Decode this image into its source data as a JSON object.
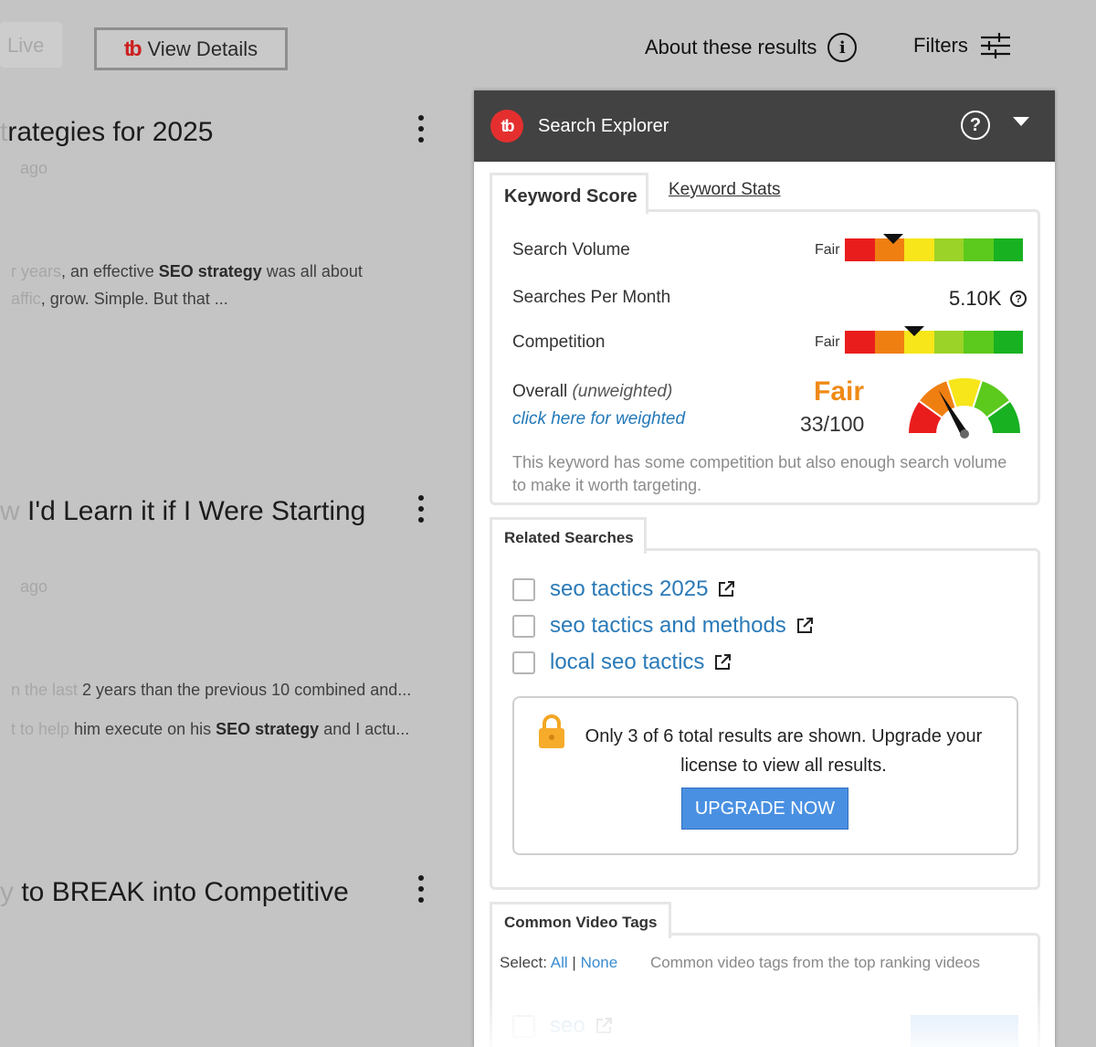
{
  "topbar": {
    "live_chip": "Live",
    "view_details_logo": "tb",
    "view_details": "View Details",
    "about_results": "About these results",
    "info_icon": "i",
    "filters": "Filters"
  },
  "videos": [
    {
      "title_fade": "t",
      "title": "rategies for 2025",
      "meta": "ago",
      "desc_lines": [
        {
          "fade": "r years",
          "pre": ", an effective ",
          "bold": "SEO strategy",
          "post": " was all about"
        },
        {
          "fade": "affic",
          "pre": ", grow. Simple. But that ...",
          "bold": "",
          "post": ""
        }
      ]
    },
    {
      "title_fade": "w",
      "title": " I'd Learn it if I Were Starting",
      "meta": "ago",
      "desc_lines": [
        {
          "fade": "n the last",
          "pre": " 2 years than the previous 10 combined and...",
          "bold": "",
          "post": ""
        },
        {
          "fade": "t to help",
          "pre": " him execute on his ",
          "bold": "SEO strategy",
          "post": " and I actu..."
        }
      ]
    },
    {
      "title_fade": "y",
      "title": " to BREAK into Competitive",
      "meta": "",
      "desc_lines": []
    }
  ],
  "panel": {
    "logo": "tb",
    "title": "Search Explorer",
    "help_icon": "?",
    "tabs": {
      "keyword_score": "Keyword Score",
      "keyword_stats": "Keyword Stats"
    },
    "score": {
      "search_volume_label": "Search Volume",
      "search_volume_rating": "Fair",
      "search_volume_level": 0.27,
      "spm_label": "Searches Per Month",
      "spm_value": "5.10K",
      "spm_help": "?",
      "competition_label": "Competition",
      "competition_rating": "Fair",
      "competition_level": 0.39,
      "overall_label": "Overall",
      "overall_note": "(unweighted)",
      "weighted_link": "click here for weighted",
      "overall_rating": "Fair",
      "overall_score": "33/100",
      "overall_value": 33,
      "description": "This keyword has some competition but also enough search volume to make it worth targeting."
    },
    "meter_colors": [
      "#ea1d1d",
      "#f07f12",
      "#f6e61a",
      "#9bd328",
      "#5cc91d",
      "#18b121"
    ],
    "related": {
      "heading": "Related Searches",
      "items": [
        "seo tactics 2025",
        "seo tactics and methods",
        "local seo tactics"
      ],
      "upgrade_message": "Only 3 of 6 total results are shown. Upgrade your license to view all results.",
      "upgrade_button": "UPGRADE NOW"
    },
    "tags": {
      "heading": "Common Video Tags",
      "select_label": "Select:",
      "select_all": "All",
      "select_separator": "|",
      "select_none": "None",
      "description": "Common video tags from the top ranking videos",
      "first_tag": "seo"
    }
  }
}
